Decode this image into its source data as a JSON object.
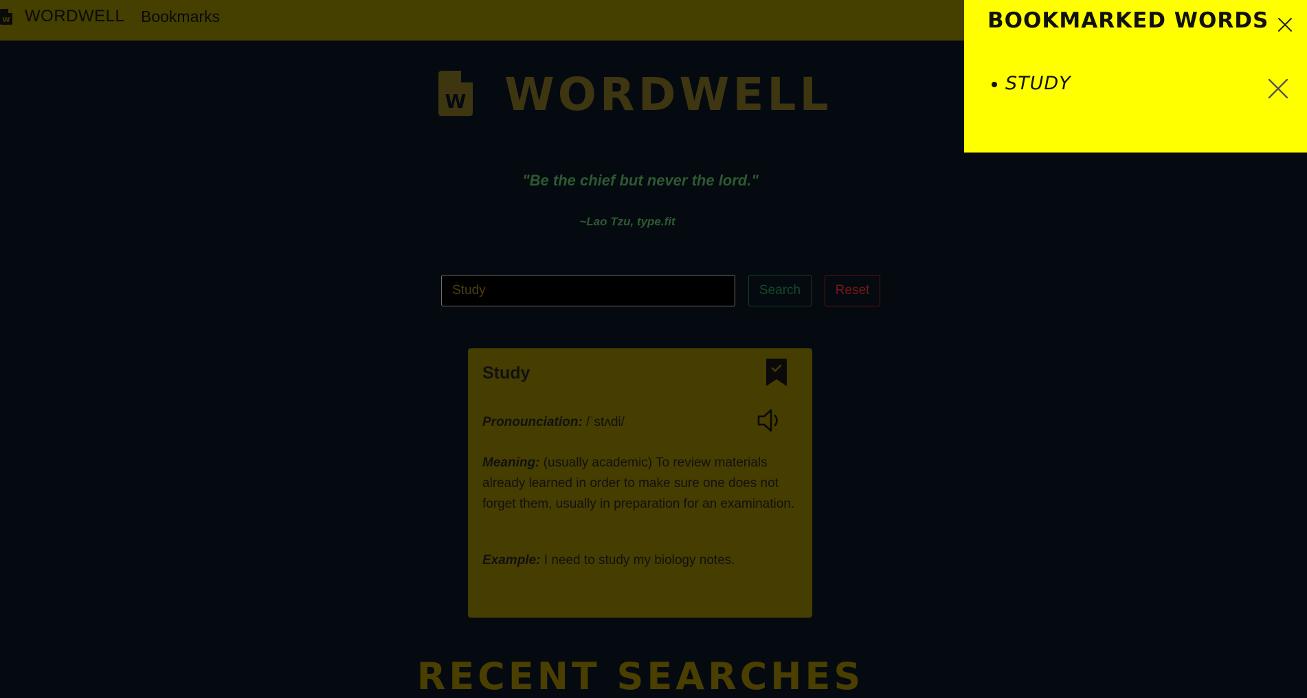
{
  "colors": {
    "navbar_bg": "#453f00",
    "page_bg": "#050a11",
    "panel_bg": "#ffff00",
    "card_bg": "#463d00",
    "quote_color": "#2d5a30",
    "search_accent": "#124a28",
    "reset_accent": "#7a1515"
  },
  "navbar": {
    "brand": "WORDWELL",
    "bookmarks_link": "Bookmarks",
    "logo_icon": "file-w-icon"
  },
  "hero": {
    "title": "WORDWELL",
    "icon": "file-w-icon"
  },
  "quote": {
    "text": "\"Be the chief but never the lord.\"",
    "author": "~Lao Tzu, type.fit"
  },
  "search": {
    "value": "Study",
    "search_label": "Search",
    "reset_label": "Reset"
  },
  "card": {
    "word": "Study",
    "pronunciation_label": "Pronounciation:",
    "pronunciation": " /ˈstʌdi/",
    "meaning_label": "Meaning:",
    "meaning": " (usually academic) To review materials already learned in order to make sure one does not forget them, usually in preparation for an examination.",
    "example_label": "Example:",
    "example": " I need to study my biology notes.",
    "bookmark_icon": "bookmark-check-icon",
    "speaker_icon": "speaker-icon"
  },
  "recent": {
    "title": "RECENT SEARCHES"
  },
  "bookmark_panel": {
    "title": "BOOKMARKED WORDS",
    "items": [
      {
        "word": "STUDY"
      }
    ]
  }
}
